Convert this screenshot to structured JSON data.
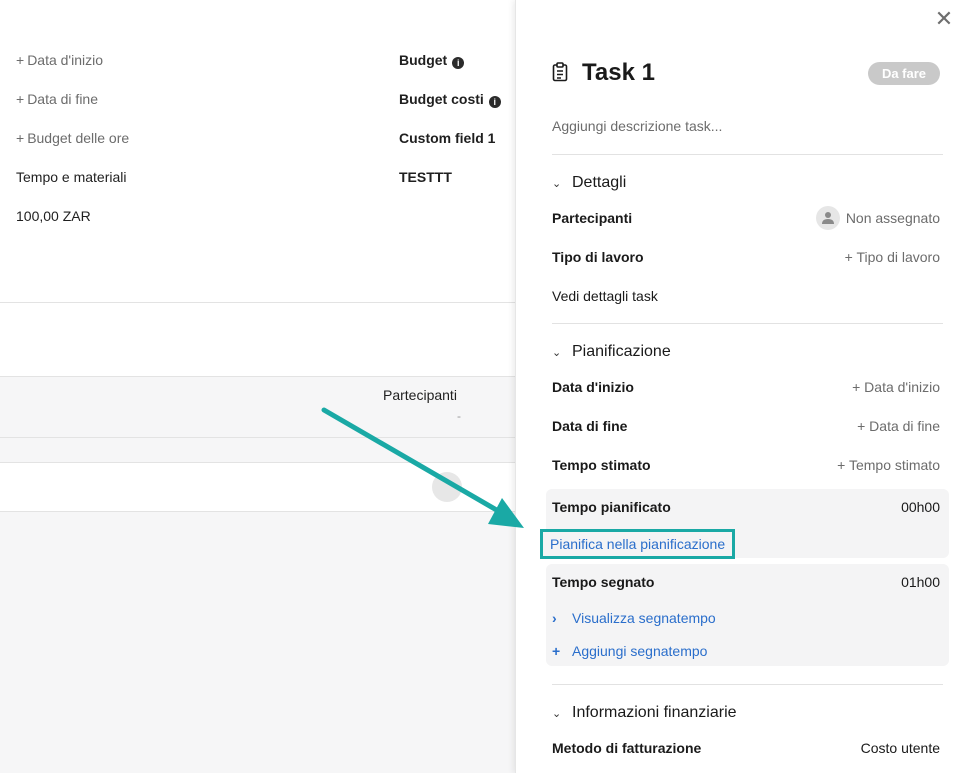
{
  "background": {
    "left_fields": [
      {
        "label": "Data d'inizio",
        "type": "add"
      },
      {
        "label": "Data di fine",
        "type": "add"
      },
      {
        "label": "Budget delle ore",
        "type": "add"
      },
      {
        "label": "Tempo e materiali",
        "type": "text"
      },
      {
        "label": "100,00 ZAR",
        "type": "text"
      }
    ],
    "right_fields": [
      {
        "label": "Budget",
        "info": true
      },
      {
        "label": "Budget costi",
        "info": true
      },
      {
        "label": "Custom field 1",
        "info": false
      },
      {
        "label": "TESTTT",
        "info": false
      }
    ],
    "table_header": "Partecipanti",
    "table_dash": "-"
  },
  "panel": {
    "title": "Task 1",
    "status": "Da fare",
    "description_placeholder": "Aggiungi descrizione task...",
    "details": {
      "heading": "Dettagli",
      "participants_label": "Partecipanti",
      "participants_value": "Non assegnato",
      "work_type_label": "Tipo di lavoro",
      "work_type_value": "+ Tipo di lavoro",
      "details_link": "Vedi dettagli task"
    },
    "planning": {
      "heading": "Pianificazione",
      "start_label": "Data d'inizio",
      "start_value": "+ Data d'inizio",
      "end_label": "Data di fine",
      "end_value": "+ Data di fine",
      "estimated_label": "Tempo stimato",
      "estimated_value": "+ Tempo stimato",
      "planned_label": "Tempo pianificato",
      "planned_value": "00h00",
      "plan_link": "Pianifica nella pianificazione",
      "logged_label": "Tempo segnato",
      "logged_value": "01h00",
      "view_timesheet": "Visualizza segnatempo",
      "add_timesheet": "Aggiungi segnatempo"
    },
    "financial": {
      "heading": "Informazioni finanziarie",
      "billing_label": "Metodo di fatturazione",
      "billing_value": "Costo utente"
    }
  },
  "colors": {
    "link": "#2a6ecb",
    "highlight": "#1aa9a5",
    "status_badge": "#c9c9c9"
  },
  "icons": [
    "close-icon",
    "clipboard-icon",
    "chevron-down-icon",
    "chevron-right-icon",
    "plus-icon",
    "info-icon",
    "user-icon",
    "annotation-arrow"
  ]
}
